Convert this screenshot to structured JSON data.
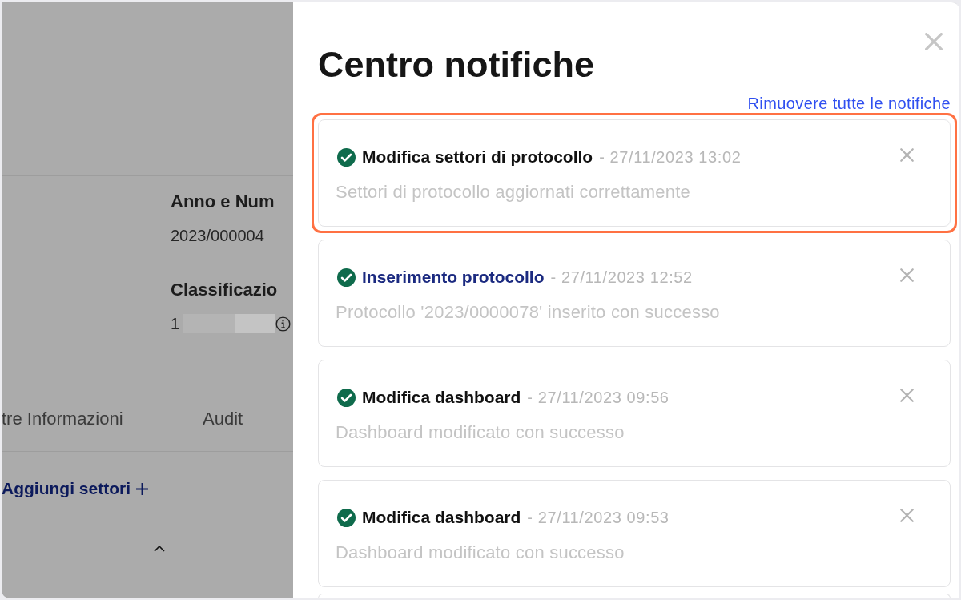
{
  "background_page": {
    "fields": [
      {
        "kind": "plain",
        "label": "Anno e Num",
        "value": "2023/000004"
      },
      {
        "kind": "redacted",
        "label": "Classificazio",
        "value": "1"
      }
    ],
    "tabs": [
      {
        "label": "tre Informazioni"
      },
      {
        "label": "Audit"
      }
    ],
    "add_sectors_link": {
      "label": "Aggiungi settori"
    }
  },
  "notification_center": {
    "title": "Centro notifiche",
    "clear_all_link": "Rimuovere tutte le notifiche",
    "notifications": [
      {
        "selected": true,
        "kind": "text",
        "title": "Modifica settori di protocollo",
        "time": "- 27/11/2023 13:02",
        "message": "Settori di protocollo aggiornati correttamente"
      },
      {
        "selected": false,
        "kind": "link",
        "title": "Inserimento protocollo",
        "time": "- 27/11/2023 12:52",
        "message": "Protocollo '2023/0000078' inserito con successo"
      },
      {
        "selected": false,
        "kind": "text",
        "title": "Modifica dashboard",
        "time": "- 27/11/2023 09:56",
        "message": "Dashboard modificato con successo"
      },
      {
        "selected": false,
        "kind": "text",
        "title": "Modifica dashboard",
        "time": "- 27/11/2023 09:53",
        "message": "Dashboard modificato con successo"
      }
    ]
  }
}
